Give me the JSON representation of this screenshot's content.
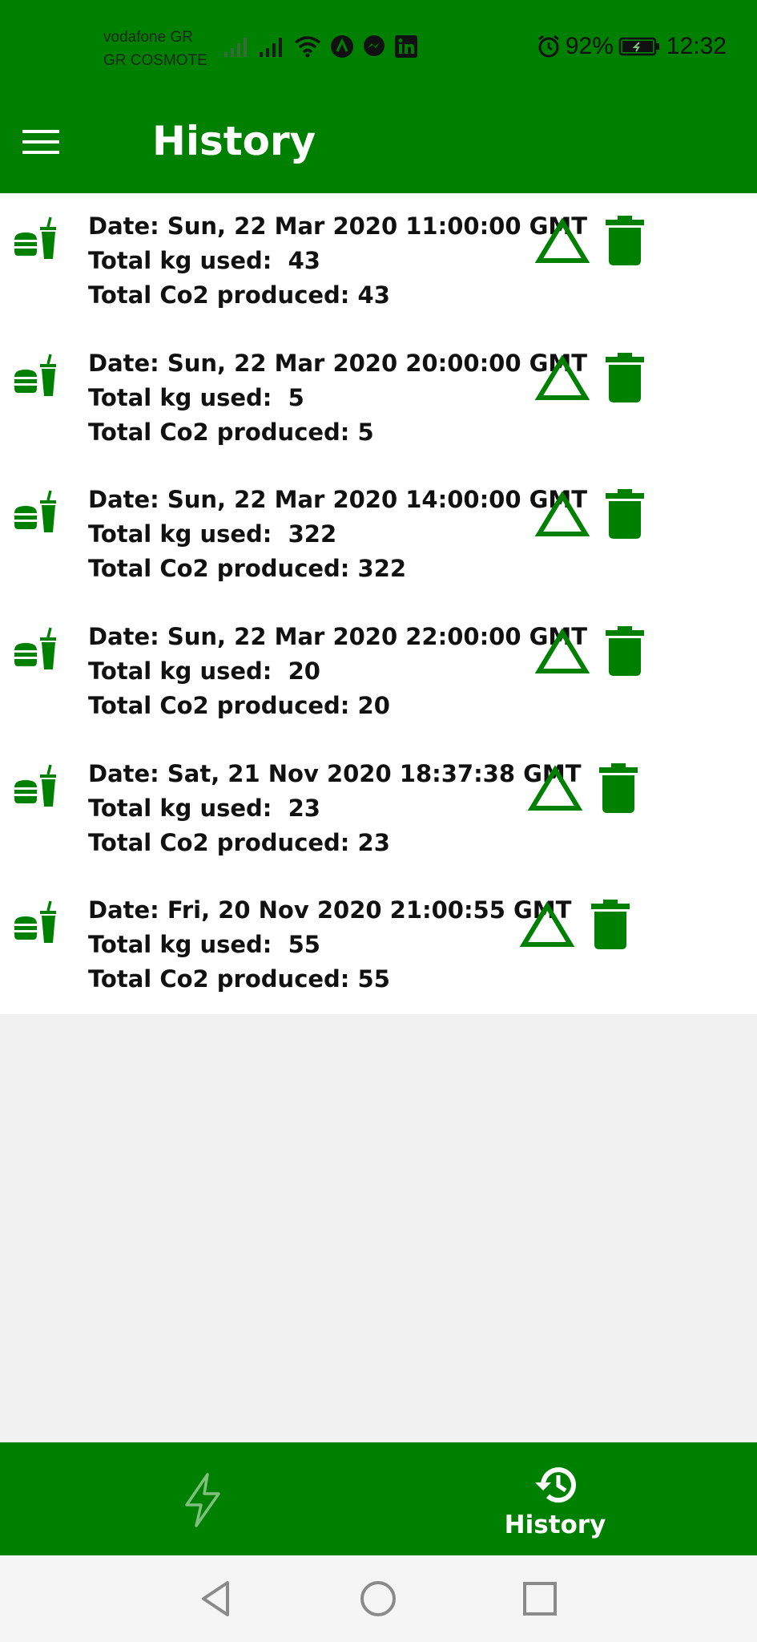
{
  "status_bar": {
    "carrier_1": "vodafone GR",
    "carrier_2": "GR COSMOTE",
    "battery": "92%",
    "time": "12:32",
    "icons": [
      "signal-icon",
      "signal-icon",
      "wifi-icon",
      "app-notification-icon",
      "messenger-icon",
      "linkedin-icon",
      "alarm-icon",
      "battery-icon"
    ]
  },
  "app_bar": {
    "title": "History",
    "menu_icon": "hamburger-menu-icon"
  },
  "history": {
    "labels": {
      "date": "Date: ",
      "kg": "Total kg used:  ",
      "co2": "Total Co2 produced: "
    },
    "items": [
      {
        "date": "Sun, 22 Mar 2020 11:00:00 GMT",
        "kg": "43",
        "co2": "43"
      },
      {
        "date": "Sun, 22 Mar 2020 20:00:00 GMT",
        "kg": "5",
        "co2": "5"
      },
      {
        "date": "Sun, 22 Mar 2020 14:00:00 GMT",
        "kg": "322",
        "co2": "322"
      },
      {
        "date": "Sun, 22 Mar 2020 22:00:00 GMT",
        "kg": "20",
        "co2": "20"
      },
      {
        "date": "Sat, 21 Nov 2020 18:37:38 GMT",
        "kg": "23",
        "co2": "23"
      },
      {
        "date": "Fri, 20 Nov 2020 21:00:55 GMT",
        "kg": "55",
        "co2": "55"
      }
    ],
    "item_icon": "fastfood-icon",
    "action_icons": [
      "triangle-icon",
      "trash-icon"
    ]
  },
  "bottom_nav": {
    "items": [
      {
        "icon": "lightning-icon",
        "label": "",
        "active": false
      },
      {
        "icon": "history-icon",
        "label": "History",
        "active": true
      }
    ]
  },
  "system_nav": {
    "icons": [
      "back-icon",
      "home-icon",
      "recents-icon"
    ]
  },
  "colors": {
    "primary": "#008000",
    "background": "#f1f1f1",
    "list_background": "#ffffff",
    "text": "#111111"
  }
}
